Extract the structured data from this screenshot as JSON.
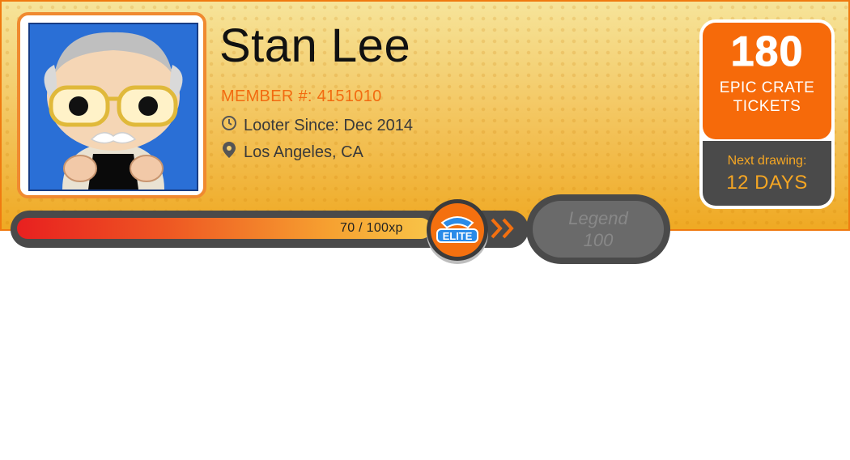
{
  "profile": {
    "name": "Stan Lee",
    "member_label": "MEMBER #: 4151010",
    "looter_since": "Looter Since: Dec 2014",
    "location": "Los Angeles, CA"
  },
  "tickets": {
    "count": "180",
    "label_line1": "EPIC CRATE",
    "label_line2": "TICKETS",
    "next_label": "Next drawing:",
    "next_value": "12 DAYS"
  },
  "xp": {
    "text": "70 / 100xp",
    "progress_fraction": 0.7,
    "badge_label": "ELITE",
    "next_level_name": "Legend",
    "next_level_value": "100"
  },
  "colors": {
    "accent": "#f26b10",
    "badge_blue": "#2a8be8"
  },
  "icons": {
    "clock": "clock-icon",
    "location": "location-pin-icon",
    "chevrons": "double-chevron-right-icon"
  }
}
